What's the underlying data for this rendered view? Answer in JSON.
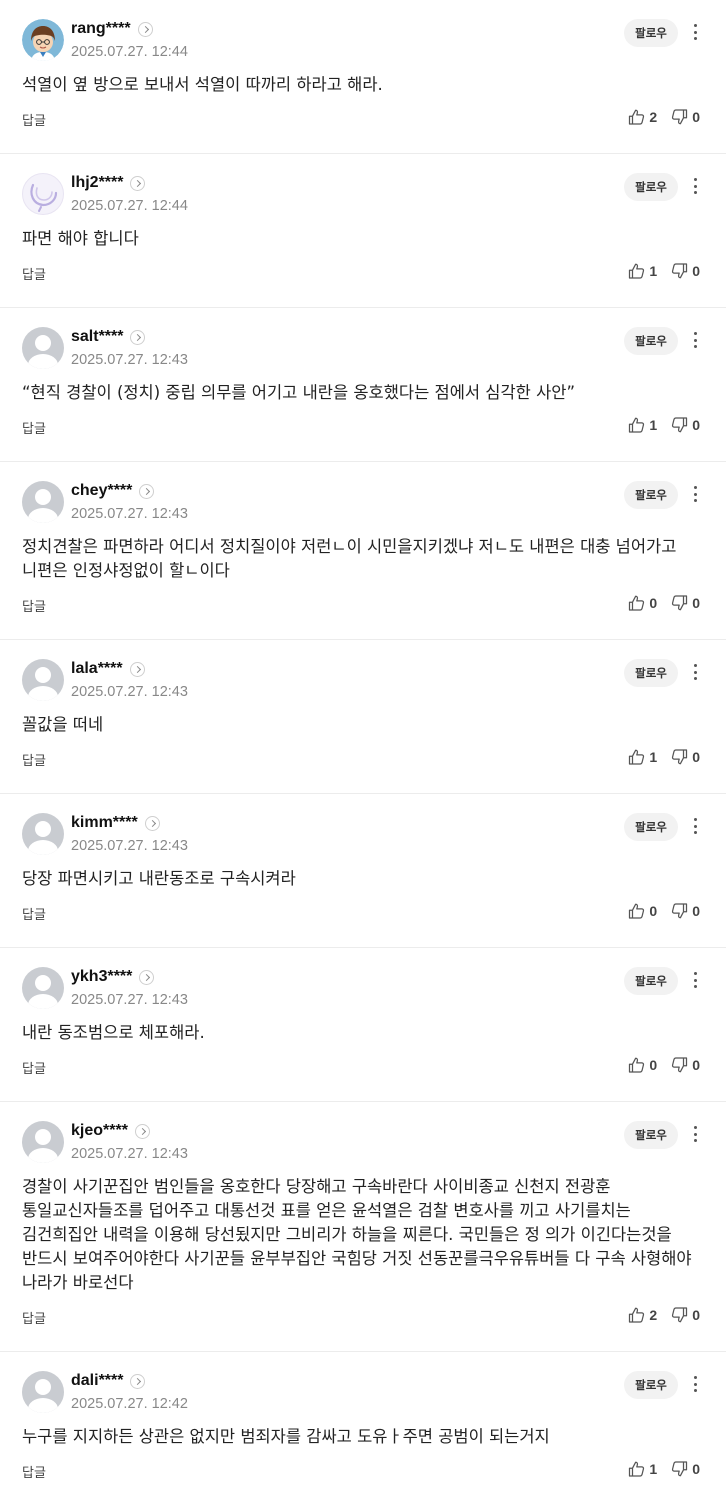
{
  "labels": {
    "follow": "팔로우",
    "reply": "답글"
  },
  "comments": [
    {
      "nick": "rang****",
      "date": "2025.07.27. 12:44",
      "text": "석열이 옆 방으로 보내서 석열이 따까리 하라고 해라.",
      "likes": "2",
      "dislikes": "0",
      "avatar": "cartoon"
    },
    {
      "nick": "lhj2****",
      "date": "2025.07.27. 12:44",
      "text": "파면 해야 합니다",
      "likes": "1",
      "dislikes": "0",
      "avatar": "swirl"
    },
    {
      "nick": "salt****",
      "date": "2025.07.27. 12:43",
      "text": "“현직 경찰이 (정치) 중립 의무를 어기고 내란을 옹호했다는 점에서 심각한 사안”",
      "likes": "1",
      "dislikes": "0",
      "avatar": "default"
    },
    {
      "nick": "chey****",
      "date": "2025.07.27. 12:43",
      "text": "정치견찰은 파면하라 어디서 정치질이야 저런ㄴ이 시민을지키겠냐 저ㄴ도 내편은 대충 넘어가고 니편은 인정샤정없이 할ㄴ이다",
      "likes": "0",
      "dislikes": "0",
      "avatar": "default"
    },
    {
      "nick": "lala****",
      "date": "2025.07.27. 12:43",
      "text": "꼴값을 떠네",
      "likes": "1",
      "dislikes": "0",
      "avatar": "default"
    },
    {
      "nick": "kimm****",
      "date": "2025.07.27. 12:43",
      "text": "당장 파면시키고 내란동조로 구속시켜라",
      "likes": "0",
      "dislikes": "0",
      "avatar": "default"
    },
    {
      "nick": "ykh3****",
      "date": "2025.07.27. 12:43",
      "text": "내란 동조범으로 체포해라.",
      "likes": "0",
      "dislikes": "0",
      "avatar": "default"
    },
    {
      "nick": "kjeo****",
      "date": "2025.07.27. 12:43",
      "text": "경찰이 사기꾼집안 범인들을 옹호한다 당장해고 구속바란다 사이비종교 신천지 전광훈 통일교신자들조를 덥어주고 대통선것 표를 얻은 윤석열은 검찰 변호사를 끼고 사기를치는 김건희집안 내력을 이용해 당선됬지만 그비리가 하늘을 찌른다. 국민들은 정 의가 이긴다는것을 반드시 보여주어야한다 사기꾼들 윤부부집안 국힘당 거짓 선동꾼를극우유튜버들 다 구속 사형해야 나라가 바로선다",
      "likes": "2",
      "dislikes": "0",
      "avatar": "default"
    },
    {
      "nick": "dali****",
      "date": "2025.07.27. 12:42",
      "text": "누구를 지지하든 상관은 없지만 범죄자를 감싸고 도유ㅏ주면 공범이 되는거지",
      "likes": "1",
      "dislikes": "0",
      "avatar": "default"
    }
  ]
}
